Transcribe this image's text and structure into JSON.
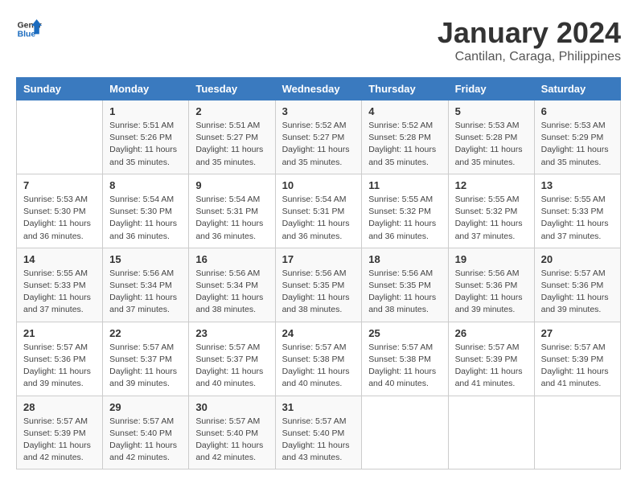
{
  "header": {
    "logo_general": "General",
    "logo_blue": "Blue",
    "month_year": "January 2024",
    "location": "Cantilan, Caraga, Philippines"
  },
  "weekdays": [
    "Sunday",
    "Monday",
    "Tuesday",
    "Wednesday",
    "Thursday",
    "Friday",
    "Saturday"
  ],
  "weeks": [
    [
      {
        "day": "",
        "sunrise": "",
        "sunset": "",
        "daylight": ""
      },
      {
        "day": "1",
        "sunrise": "5:51 AM",
        "sunset": "5:26 PM",
        "daylight": "11 hours and 35 minutes."
      },
      {
        "day": "2",
        "sunrise": "5:51 AM",
        "sunset": "5:27 PM",
        "daylight": "11 hours and 35 minutes."
      },
      {
        "day": "3",
        "sunrise": "5:52 AM",
        "sunset": "5:27 PM",
        "daylight": "11 hours and 35 minutes."
      },
      {
        "day": "4",
        "sunrise": "5:52 AM",
        "sunset": "5:28 PM",
        "daylight": "11 hours and 35 minutes."
      },
      {
        "day": "5",
        "sunrise": "5:53 AM",
        "sunset": "5:28 PM",
        "daylight": "11 hours and 35 minutes."
      },
      {
        "day": "6",
        "sunrise": "5:53 AM",
        "sunset": "5:29 PM",
        "daylight": "11 hours and 35 minutes."
      }
    ],
    [
      {
        "day": "7",
        "sunrise": "5:53 AM",
        "sunset": "5:30 PM",
        "daylight": "11 hours and 36 minutes."
      },
      {
        "day": "8",
        "sunrise": "5:54 AM",
        "sunset": "5:30 PM",
        "daylight": "11 hours and 36 minutes."
      },
      {
        "day": "9",
        "sunrise": "5:54 AM",
        "sunset": "5:31 PM",
        "daylight": "11 hours and 36 minutes."
      },
      {
        "day": "10",
        "sunrise": "5:54 AM",
        "sunset": "5:31 PM",
        "daylight": "11 hours and 36 minutes."
      },
      {
        "day": "11",
        "sunrise": "5:55 AM",
        "sunset": "5:32 PM",
        "daylight": "11 hours and 36 minutes."
      },
      {
        "day": "12",
        "sunrise": "5:55 AM",
        "sunset": "5:32 PM",
        "daylight": "11 hours and 37 minutes."
      },
      {
        "day": "13",
        "sunrise": "5:55 AM",
        "sunset": "5:33 PM",
        "daylight": "11 hours and 37 minutes."
      }
    ],
    [
      {
        "day": "14",
        "sunrise": "5:55 AM",
        "sunset": "5:33 PM",
        "daylight": "11 hours and 37 minutes."
      },
      {
        "day": "15",
        "sunrise": "5:56 AM",
        "sunset": "5:34 PM",
        "daylight": "11 hours and 37 minutes."
      },
      {
        "day": "16",
        "sunrise": "5:56 AM",
        "sunset": "5:34 PM",
        "daylight": "11 hours and 38 minutes."
      },
      {
        "day": "17",
        "sunrise": "5:56 AM",
        "sunset": "5:35 PM",
        "daylight": "11 hours and 38 minutes."
      },
      {
        "day": "18",
        "sunrise": "5:56 AM",
        "sunset": "5:35 PM",
        "daylight": "11 hours and 38 minutes."
      },
      {
        "day": "19",
        "sunrise": "5:56 AM",
        "sunset": "5:36 PM",
        "daylight": "11 hours and 39 minutes."
      },
      {
        "day": "20",
        "sunrise": "5:57 AM",
        "sunset": "5:36 PM",
        "daylight": "11 hours and 39 minutes."
      }
    ],
    [
      {
        "day": "21",
        "sunrise": "5:57 AM",
        "sunset": "5:36 PM",
        "daylight": "11 hours and 39 minutes."
      },
      {
        "day": "22",
        "sunrise": "5:57 AM",
        "sunset": "5:37 PM",
        "daylight": "11 hours and 39 minutes."
      },
      {
        "day": "23",
        "sunrise": "5:57 AM",
        "sunset": "5:37 PM",
        "daylight": "11 hours and 40 minutes."
      },
      {
        "day": "24",
        "sunrise": "5:57 AM",
        "sunset": "5:38 PM",
        "daylight": "11 hours and 40 minutes."
      },
      {
        "day": "25",
        "sunrise": "5:57 AM",
        "sunset": "5:38 PM",
        "daylight": "11 hours and 40 minutes."
      },
      {
        "day": "26",
        "sunrise": "5:57 AM",
        "sunset": "5:39 PM",
        "daylight": "11 hours and 41 minutes."
      },
      {
        "day": "27",
        "sunrise": "5:57 AM",
        "sunset": "5:39 PM",
        "daylight": "11 hours and 41 minutes."
      }
    ],
    [
      {
        "day": "28",
        "sunrise": "5:57 AM",
        "sunset": "5:39 PM",
        "daylight": "11 hours and 42 minutes."
      },
      {
        "day": "29",
        "sunrise": "5:57 AM",
        "sunset": "5:40 PM",
        "daylight": "11 hours and 42 minutes."
      },
      {
        "day": "30",
        "sunrise": "5:57 AM",
        "sunset": "5:40 PM",
        "daylight": "11 hours and 42 minutes."
      },
      {
        "day": "31",
        "sunrise": "5:57 AM",
        "sunset": "5:40 PM",
        "daylight": "11 hours and 43 minutes."
      },
      {
        "day": "",
        "sunrise": "",
        "sunset": "",
        "daylight": ""
      },
      {
        "day": "",
        "sunrise": "",
        "sunset": "",
        "daylight": ""
      },
      {
        "day": "",
        "sunrise": "",
        "sunset": "",
        "daylight": ""
      }
    ]
  ]
}
